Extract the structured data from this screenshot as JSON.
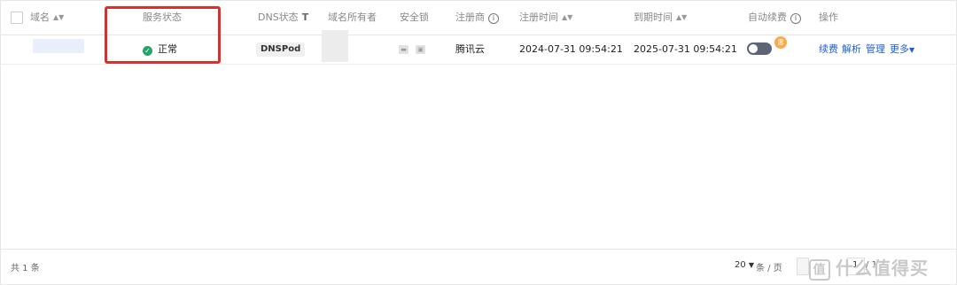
{
  "table": {
    "columns": {
      "domain": "域名",
      "service_status": "服务状态",
      "dns_status": "DNS状态",
      "owner": "域名所有者",
      "security_lock": "安全锁",
      "registrar": "注册商",
      "register_time": "注册时间",
      "expire_time": "到期时间",
      "auto_renew": "自动续费",
      "actions": "操作"
    },
    "rows": [
      {
        "status": "正常",
        "dns": "DNSPod",
        "registrar": "腾讯云",
        "register_time": "2024-07-31 09:54:21",
        "expire_time": "2025-07-31 09:54:21",
        "promo_badge": "惠",
        "auto_renew_on": false,
        "actions": [
          "续费",
          "解析",
          "管理",
          "更多"
        ]
      }
    ]
  },
  "footer": {
    "total": "共 1 条",
    "page_size": "20",
    "page_size_unit": "条 / 页",
    "page_current": "1",
    "page_total": "/ 1"
  },
  "watermark": {
    "icon": "值",
    "text": "什么值得买"
  },
  "colors": {
    "status_ok": "#29a36a",
    "link": "#1e5fd6",
    "highlight": "#d9302c",
    "toggle_off": "#5d6575",
    "promo": "#ffa84b"
  }
}
